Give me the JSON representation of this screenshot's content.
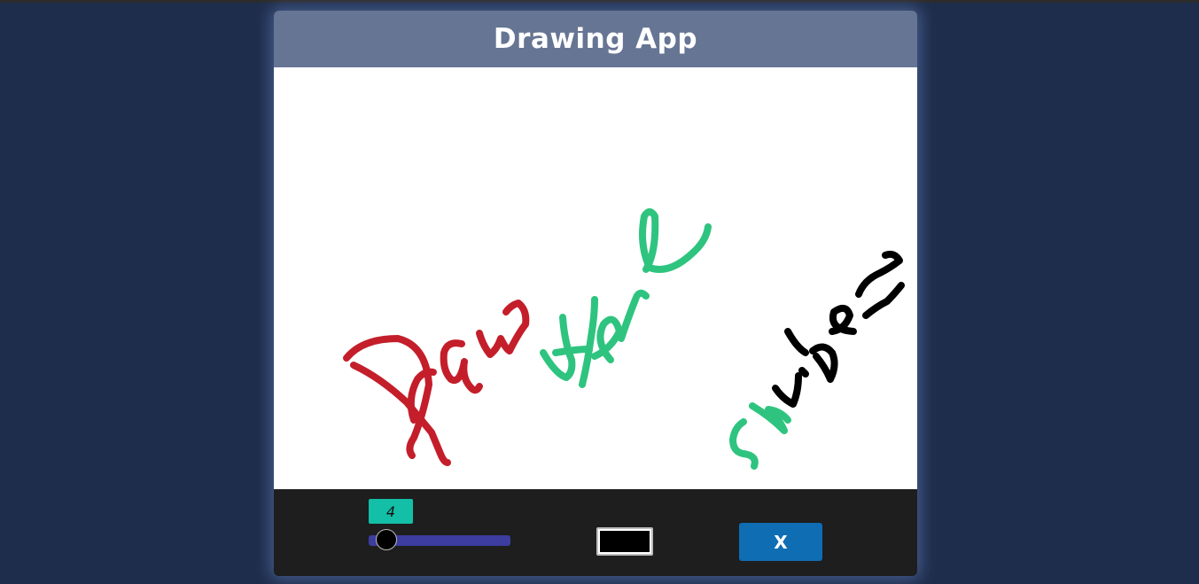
{
  "header": {
    "title": "Drawing App"
  },
  "canvas": {
    "stroke_colors": {
      "red": "#c41e2b",
      "green": "#2ec47f",
      "black": "#000000"
    }
  },
  "toolbar": {
    "brush_size": "4",
    "brush_size_value": 4,
    "brush_size_min": 1,
    "brush_size_max": 50,
    "color_value": "#000000",
    "clear_label": "X"
  },
  "colors": {
    "page_background": "#1e2d4b",
    "header_background": "#667593",
    "toolbar_background": "#1e1e1e",
    "size_badge": "#13bfa7",
    "slider_track": "#3c3d9e",
    "clear_button": "#0f6db4"
  }
}
